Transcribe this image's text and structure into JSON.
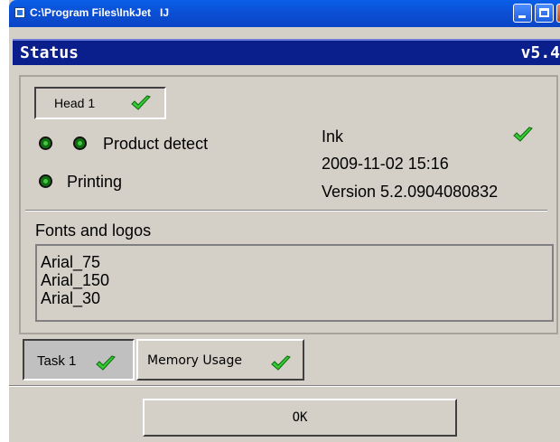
{
  "window": {
    "title": "C:\\Program Files\\InkJet   IJ"
  },
  "header": {
    "title": "Status",
    "version": "v5.4"
  },
  "head_tab": {
    "label": "Head 1",
    "checked": true
  },
  "indicators": {
    "product_detect": "Product detect",
    "printing": "Printing"
  },
  "ink": {
    "label": "Ink",
    "ok": true,
    "datetime": "2009-11-02  15:16",
    "version": "Version 5.2.0904080832"
  },
  "fonts": {
    "heading": "Fonts and logos",
    "items": [
      "Arial_75",
      "Arial_150",
      "Arial_30"
    ]
  },
  "tabs": [
    {
      "label": "Task 1",
      "checked": true,
      "selected": true
    },
    {
      "label": "Memory Usage",
      "checked": true,
      "selected": false
    }
  ],
  "ok_button": {
    "label": "OK"
  },
  "colors": {
    "accent_blue": "#0a1e8c",
    "titlebar_blue": "#0b4ed4",
    "led_green": "#46c446",
    "check_green": "#33cc33",
    "panel_gray": "#d4d0c8"
  }
}
